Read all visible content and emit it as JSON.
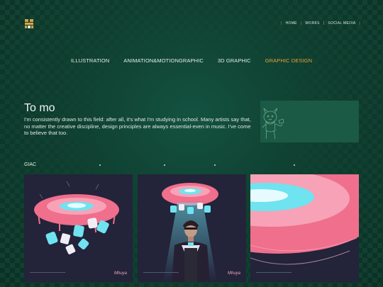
{
  "topnav": {
    "home": "HOME",
    "works": "WORKS",
    "social": "SOCIAL MEDIA"
  },
  "categories": [
    "ILLUSTRATION",
    "ANIMATION&MOTIONGRAPHIC",
    "3D GRAPHIC",
    "GRAPHIC DESIGN"
  ],
  "active_category": "GRAPHIC DESIGN",
  "intro": {
    "title": "To mo",
    "description": "I'm consistently drawn to this field: after all, it's what I'm studying in school. Many artists say that, no matter the creative discipline, design principles are always essential-even in music. I've come to believe that too."
  },
  "section": {
    "label": "GIAC"
  },
  "gallery": [
    {
      "signature": "Mhuya"
    },
    {
      "signature": "Mhuya"
    },
    {
      "signature": ""
    }
  ],
  "colors": {
    "accent": "#e6a339",
    "background": "#0e3b2c",
    "card": "#23233a",
    "pink": "#ef6f8c",
    "cyan": "#6fe3ef"
  }
}
